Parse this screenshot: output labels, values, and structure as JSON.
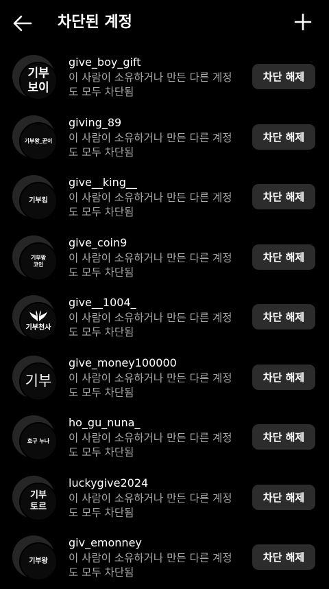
{
  "header": {
    "title": "차단된 계정",
    "back_icon": "arrow-left-icon",
    "add_icon": "plus-icon"
  },
  "accounts": [
    {
      "username": "give_boy_gift",
      "description": "이 사람이 소유하거나 만든 다른 계정도 모두 차단됨",
      "avatar_text": "기부\n보이",
      "button": "차단 해제"
    },
    {
      "username": "giving_89",
      "description": "이 사람이 소유하거나 만든 다른 계정도 모두 차단됨",
      "avatar_text": "기부왕_꾼이",
      "button": "차단 해제"
    },
    {
      "username": "give__king__",
      "description": "이 사람이 소유하거나 만든 다른 계정도 모두 차단됨",
      "avatar_text": "기부킹",
      "button": "차단 해제"
    },
    {
      "username": "give_coin9",
      "description": "이 사람이 소유하거나 만든 다른 계정도 모두 차단됨",
      "avatar_text": "기부왕\n코인",
      "button": "차단 해제"
    },
    {
      "username": "give__1004_",
      "description": "이 사람이 소유하거나 만든 다른 계정도 모두 차단됨",
      "avatar_text": "기부천사",
      "button": "차단 해제"
    },
    {
      "username": "give_money100000",
      "description": "이 사람이 소유하거나 만든 다른 계정도 모두 차단됨",
      "avatar_text": "기부",
      "button": "차단 해제"
    },
    {
      "username": "ho_gu_nuna_",
      "description": "이 사람이 소유하거나 만든 다른 계정도 모두 차단됨",
      "avatar_text": "호구 누나",
      "button": "차단 해제"
    },
    {
      "username": "luckygive2024",
      "description": "이 사람이 소유하거나 만든 다른 계정도 모두 차단됨",
      "avatar_text": "기부\n토르",
      "button": "차단 해제"
    },
    {
      "username": "giv_emonney",
      "description": "이 사람이 소유하거나 만든 다른 계정도 모두 차단됨",
      "avatar_text": "기부왕",
      "button": "차단 해제"
    }
  ],
  "colors": {
    "background": "#000000",
    "text_primary": "#ffffff",
    "text_secondary": "#a8a8a8",
    "button_bg": "#2c2c2c"
  }
}
